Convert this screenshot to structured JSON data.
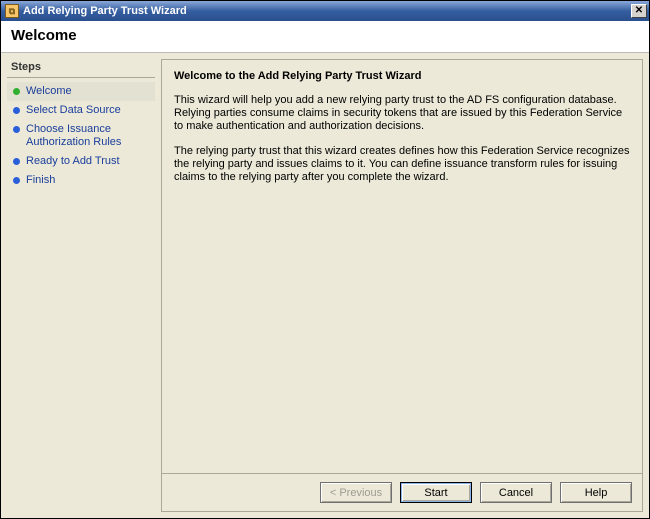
{
  "window": {
    "title": "Add Relying Party Trust Wizard",
    "close_glyph": "✕"
  },
  "subtitle": "Welcome",
  "steps": {
    "header": "Steps",
    "items": [
      {
        "label": "Welcome",
        "active": true
      },
      {
        "label": "Select Data Source",
        "active": false
      },
      {
        "label": "Choose Issuance Authorization Rules",
        "active": false
      },
      {
        "label": "Ready to Add Trust",
        "active": false
      },
      {
        "label": "Finish",
        "active": false
      }
    ]
  },
  "content": {
    "heading": "Welcome to the Add Relying Party Trust Wizard",
    "para1": "This wizard will help you add a new relying party trust to the AD FS configuration database.  Relying parties consume claims in security tokens that are issued by this Federation Service to make authentication and authorization decisions.",
    "para2": "The relying party trust that this wizard creates defines how this Federation Service recognizes the relying party and issues claims to it. You can define issuance transform rules for issuing claims to the relying party after you complete the wizard."
  },
  "buttons": {
    "previous": "< Previous",
    "start": "Start",
    "cancel": "Cancel",
    "help": "Help"
  }
}
